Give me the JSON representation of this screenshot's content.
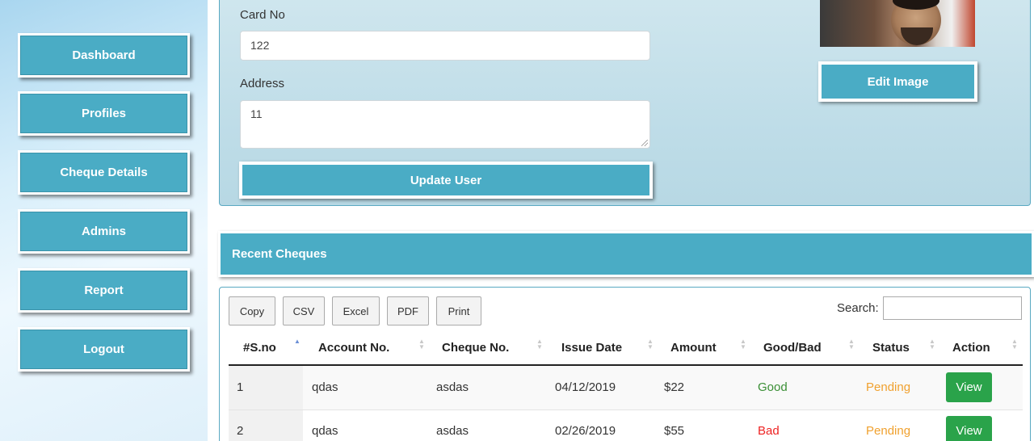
{
  "sidebar": {
    "items": [
      {
        "label": "Dashboard"
      },
      {
        "label": "Profiles"
      },
      {
        "label": "Cheque Details"
      },
      {
        "label": "Admins"
      },
      {
        "label": "Report"
      },
      {
        "label": "Logout"
      }
    ]
  },
  "profile_form": {
    "card_no_label": "Card No",
    "card_no_value": "122",
    "address_label": "Address",
    "address_value": "11",
    "update_button": "Update User",
    "edit_image_button": "Edit Image"
  },
  "recent": {
    "title": "Recent Cheques",
    "export_buttons": [
      "Copy",
      "CSV",
      "Excel",
      "PDF",
      "Print"
    ],
    "search_label": "Search:",
    "search_value": "",
    "columns": [
      "#S.no",
      "Account No.",
      "Cheque No.",
      "Issue Date",
      "Amount",
      "Good/Bad",
      "Status",
      "Action"
    ],
    "rows": [
      {
        "sno": "1",
        "account": "qdas",
        "cheque": "asdas",
        "date": "04/12/2019",
        "amount": "$22",
        "goodbad": "Good",
        "status": "Pending",
        "action": "View"
      },
      {
        "sno": "2",
        "account": "qdas",
        "cheque": "asdas",
        "date": "02/26/2019",
        "amount": "$55",
        "goodbad": "Bad",
        "status": "Pending",
        "action": "View"
      }
    ]
  },
  "colors": {
    "accent": "#4aacc5",
    "good": "#3a8f35",
    "bad": "#ee2222",
    "pending": "#f0a12f",
    "view_button": "#2aa34a"
  }
}
